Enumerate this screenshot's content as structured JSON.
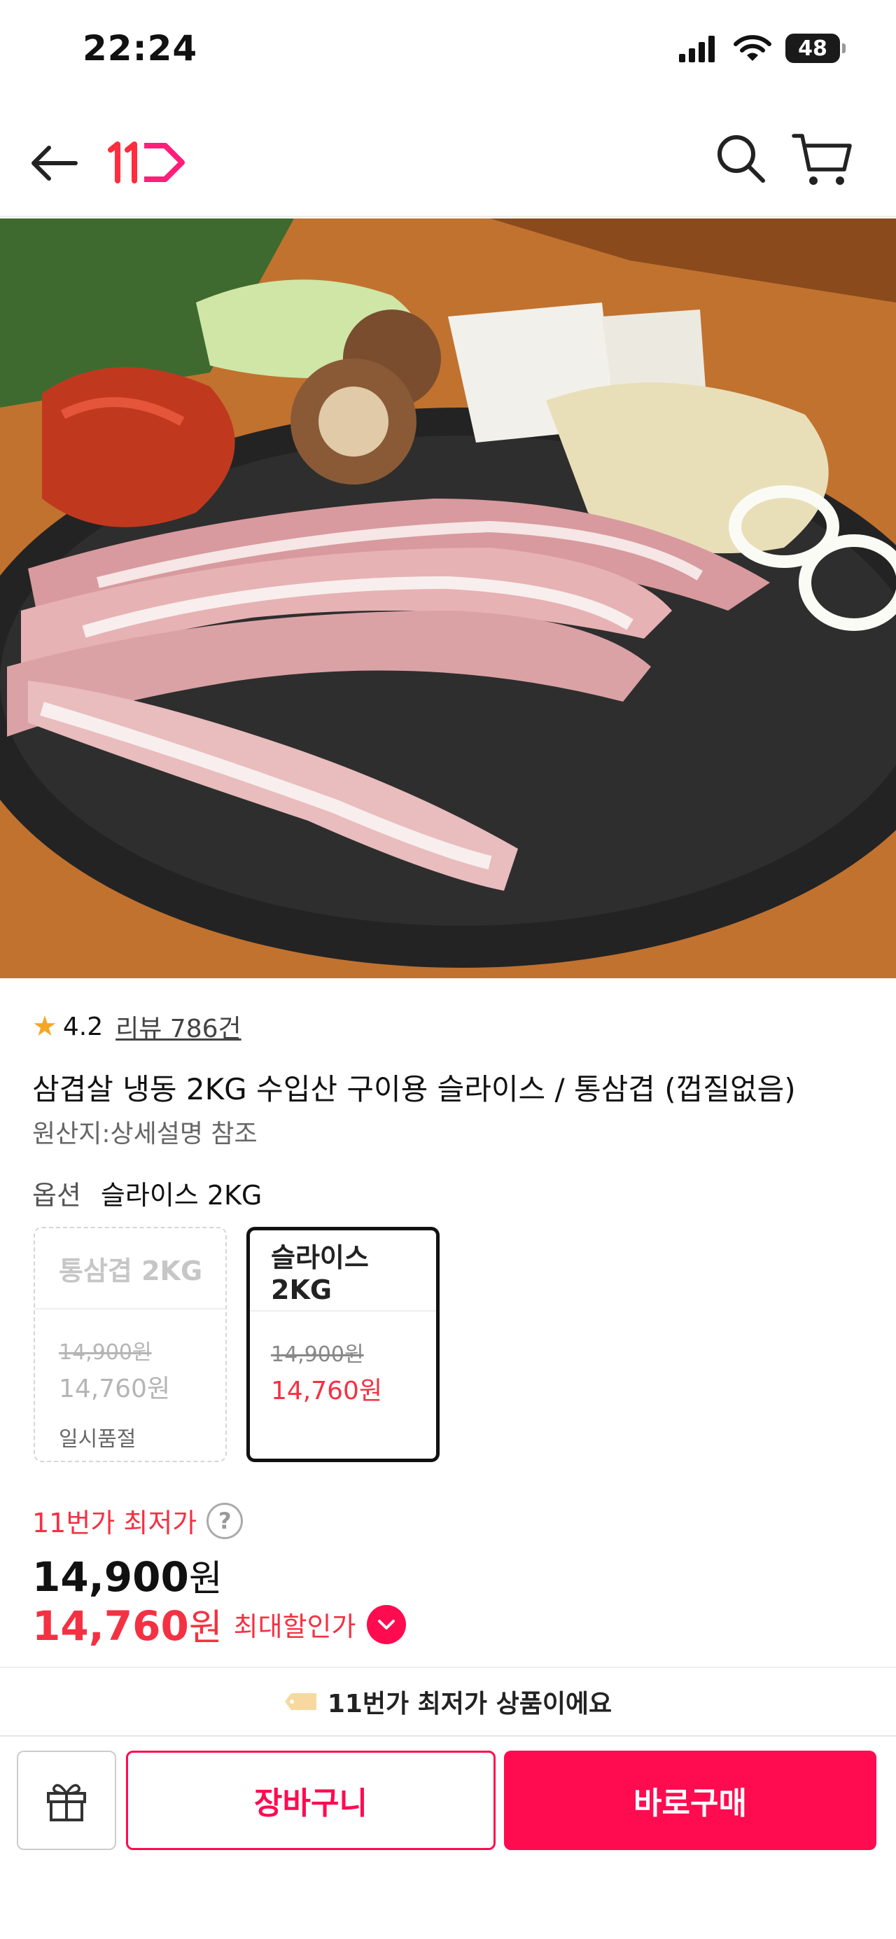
{
  "status_bar": {
    "time": "22:24",
    "battery": "48"
  },
  "header": {
    "back_icon": "arrow-left-icon",
    "logo_text": "11",
    "search_icon": "search-icon",
    "cart_icon": "cart-icon"
  },
  "product": {
    "rating": "4.2",
    "review_text": "리뷰 786건",
    "title": "삼겹살 냉동 2KG 수입산 구이용 슬라이스 / 통삼겹 (껍질없음)",
    "origin": "원산지:상세설명 참조"
  },
  "options": {
    "label": "옵션",
    "selected_value": "슬라이스 2KG",
    "cards": [
      {
        "name": "통삼겹 2KG",
        "original_price": "14,900원",
        "price": "14,760원",
        "status": "일시품절"
      },
      {
        "name": "슬라이스 2KG",
        "original_price": "14,900원",
        "price": "14,760원",
        "status": ""
      }
    ]
  },
  "pricing": {
    "lowest_label": "11번가 최저가",
    "help_icon": "?",
    "price_amount": "14,900",
    "sale_amount": "14,760",
    "currency": "원",
    "sale_label": "최대할인가"
  },
  "banner": {
    "text": "11번가 최저가 상품이에요"
  },
  "actions": {
    "cart_label": "장바구니",
    "buy_label": "바로구매"
  },
  "colors": {
    "accent": "#ff0b50",
    "price_red": "#f43142",
    "star": "#f5a623"
  }
}
